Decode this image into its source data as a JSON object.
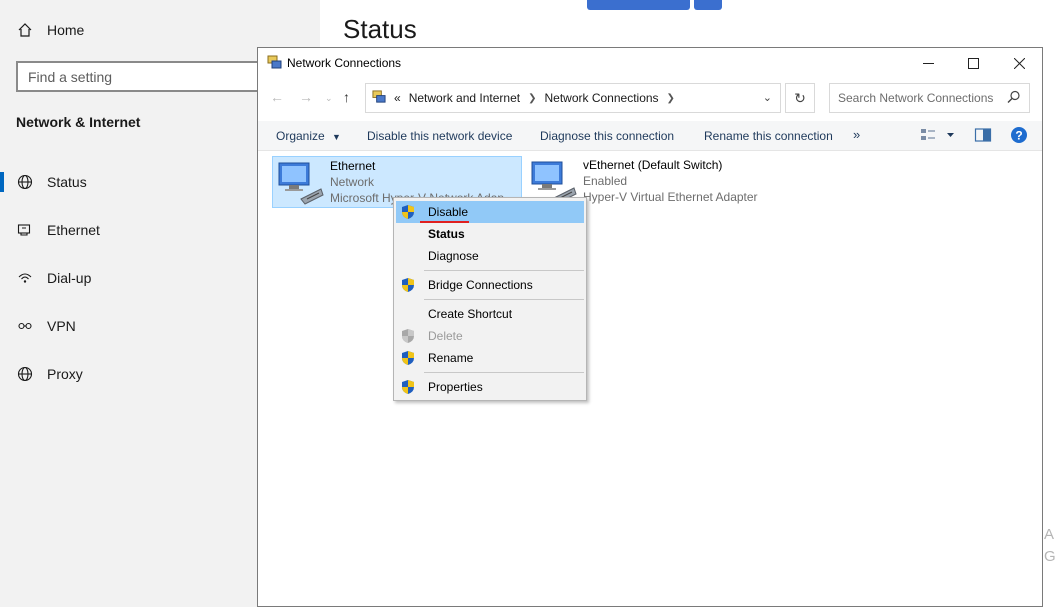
{
  "settings": {
    "home_label": "Home",
    "search_placeholder": "Find a setting",
    "section_title": "Network & Internet",
    "nav_items": [
      {
        "label": "Status",
        "icon": "globe-icon"
      },
      {
        "label": "Ethernet",
        "icon": "ethernet-icon"
      },
      {
        "label": "Dial-up",
        "icon": "dialup-icon"
      },
      {
        "label": "VPN",
        "icon": "vpn-icon"
      },
      {
        "label": "Proxy",
        "icon": "globe-icon"
      }
    ],
    "active_nav": "Status",
    "page_title": "Status",
    "edge_letters": [
      "A",
      "G"
    ]
  },
  "window": {
    "title": "Network Connections",
    "controls": [
      "minimize",
      "maximize",
      "close"
    ],
    "address": {
      "prefix": "«",
      "crumbs": [
        "Network and Internet",
        "Network Connections"
      ]
    },
    "search_placeholder": "Search Network Connections"
  },
  "toolbar": {
    "organize": "Organize",
    "disable_device": "Disable this network device",
    "diagnose": "Diagnose this connection",
    "rename": "Rename this connection",
    "more": "»"
  },
  "connections": [
    {
      "name": "Ethernet",
      "status": "Network",
      "adapter": "Microsoft Hyper-V Network Adap",
      "selected": true
    },
    {
      "name": "vEthernet (Default Switch)",
      "status": "Enabled",
      "adapter": "Hyper-V Virtual Ethernet Adapter",
      "selected": false
    }
  ],
  "context_menu": {
    "items": [
      {
        "label": "Disable",
        "shield": true
      },
      {
        "label": "Status",
        "bold": true
      },
      {
        "label": "Diagnose"
      },
      {
        "label": "Bridge Connections",
        "shield": true
      },
      {
        "label": "Create Shortcut"
      },
      {
        "label": "Delete",
        "shield": true,
        "disabled": true
      },
      {
        "label": "Rename",
        "shield": true
      },
      {
        "label": "Properties",
        "shield": true
      }
    ],
    "highlighted": "Disable"
  },
  "colors": {
    "accent": "#0067c0",
    "selection": "#cce8ff",
    "menu_highlight": "#91c9f7",
    "annotation_red": "#e02020"
  }
}
